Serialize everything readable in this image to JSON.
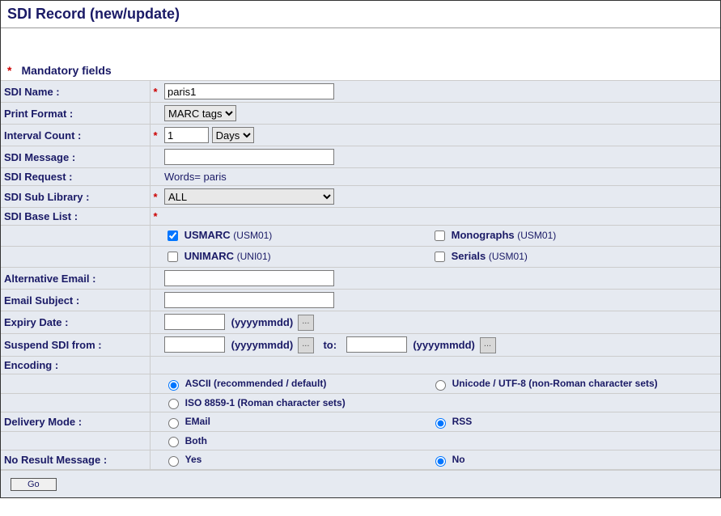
{
  "header": {
    "title": "SDI Record (new/update)",
    "mandatory_label": "Mandatory fields"
  },
  "labels": {
    "sdi_name": "SDI Name :",
    "print_format": "Print Format :",
    "interval_count": "Interval Count :",
    "sdi_message": "SDI Message :",
    "sdi_request": "SDI Request :",
    "sdi_sub_library": "SDI Sub Library :",
    "sdi_base_list": "SDI Base List :",
    "alternative_email": "Alternative Email :",
    "email_subject": "Email Subject :",
    "expiry_date": "Expiry Date :",
    "suspend_from": "Suspend SDI from  :",
    "encoding": "Encoding :",
    "delivery_mode": "Delivery Mode :",
    "no_result_message": "No Result Message :",
    "date_fmt": "(yyyymmdd)",
    "to": "to:"
  },
  "values": {
    "sdi_name": "paris1",
    "print_format": "MARC tags",
    "interval_count": "1",
    "interval_unit": "Days",
    "sdi_message": "",
    "sdi_request": "Words= paris",
    "sdi_sub_library": "ALL",
    "alternative_email": "",
    "email_subject": "",
    "expiry_date": "",
    "suspend_from": "",
    "suspend_to": ""
  },
  "base_list": {
    "usmarc": {
      "label": "USMARC ",
      "paren": "(USM01)",
      "checked": true
    },
    "monographs": {
      "label": "Monographs ",
      "paren": "(USM01)",
      "checked": false
    },
    "unimarc": {
      "label": "UNIMARC ",
      "paren": "(UNI01)",
      "checked": false
    },
    "serials": {
      "label": "Serials ",
      "paren": "(USM01)",
      "checked": false
    }
  },
  "encoding": {
    "ascii": {
      "label": "ASCII (recommended / default)",
      "checked": true
    },
    "unicode": {
      "label": "Unicode / UTF-8 (non-Roman character sets)",
      "checked": false
    },
    "iso": {
      "label": "ISO 8859-1 (Roman character sets)",
      "checked": false
    }
  },
  "delivery": {
    "email": {
      "label": "EMail",
      "checked": false
    },
    "rss": {
      "label": "RSS",
      "checked": true
    },
    "both": {
      "label": "Both",
      "checked": false
    }
  },
  "no_result": {
    "yes": {
      "label": "Yes",
      "checked": false
    },
    "no": {
      "label": "No",
      "checked": true
    }
  },
  "buttons": {
    "go": "Go"
  }
}
